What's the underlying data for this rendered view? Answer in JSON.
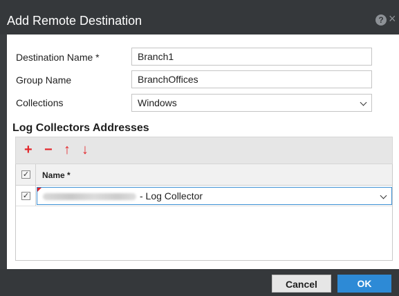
{
  "dialog": {
    "title": "Add Remote Destination",
    "help_icon_glyph": "?",
    "close_icon_glyph": "×"
  },
  "form": {
    "destination_name_label": "Destination Name *",
    "destination_name_value": "Branch1",
    "group_name_label": "Group Name",
    "group_name_value": "BranchOffices",
    "collections_label": "Collections",
    "collections_value": "Windows"
  },
  "collectors": {
    "section_title": "Log Collectors Addresses",
    "toolbar": {
      "add_glyph": "+",
      "remove_glyph": "−",
      "move_up_glyph": "↑",
      "move_down_glyph": "↓"
    },
    "header_check": "✓",
    "column_name": "Name *",
    "rows": [
      {
        "checked": "✓",
        "address_suffix": "- Log Collector"
      }
    ]
  },
  "footer": {
    "cancel_label": "Cancel",
    "ok_label": "OK"
  },
  "colors": {
    "accent": "#2d8ad6",
    "toolbar_icon": "#e3262b",
    "chrome": "#35383b"
  }
}
